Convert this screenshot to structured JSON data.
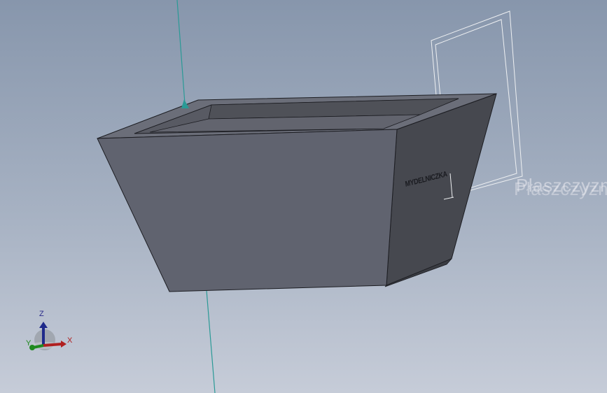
{
  "viewport": {
    "part_engraving": "MYDELNICZKA",
    "plane_label": "Płaszczyzna",
    "colors": {
      "face_front": "#60636f",
      "face_side": "#46484f",
      "face_top_rim": "#6b6e79",
      "inner_wall": "#55575f",
      "edges": "#1c1d22",
      "axis_line": "#2a9a96",
      "plane_outline": "#eef0f2",
      "background_top": "#8796ac",
      "background_bottom": "#c6ccd8"
    }
  },
  "triad": {
    "x_label": "X",
    "y_label": "Y",
    "z_label": "Z",
    "x_color": "#b02020",
    "y_color": "#1f8a1f",
    "z_color": "#1f2a8a"
  }
}
